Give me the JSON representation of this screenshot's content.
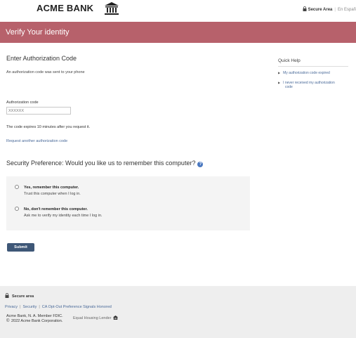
{
  "header": {
    "brand": "ACME BANK",
    "secure_area": "Secure Area",
    "language_link": "En Españ"
  },
  "banner": {
    "title": "Verify Your identity"
  },
  "auth": {
    "heading": "Enter Authorization Code",
    "sent_message": "An authorization code was sent to your phone",
    "field_label": "Authorization code",
    "field_placeholder": "XXXXXX",
    "expire_note": "The code expires 10 minutes after you request it.",
    "request_link": "Request another authorization code"
  },
  "quick_help": {
    "title": "Quick Help",
    "links": [
      {
        "line1": "My authorization code expired",
        "line2": ""
      },
      {
        "line1": "I never received my authorization",
        "line2": "code"
      }
    ]
  },
  "security": {
    "question": "Security Preference: Would you like us to remember this computer?",
    "options": [
      {
        "title": "Yes, remember this computer.",
        "desc": "Trust this computer when I log in."
      },
      {
        "title": "No, don't remember this computer.",
        "desc": "Ask me to verify my identity each time I log in."
      }
    ]
  },
  "submit_label": "Submit",
  "footer": {
    "secure_area": "Secure area",
    "links": [
      "Privacy",
      "Security",
      "CA Opt-Out Preference Signals Honored"
    ],
    "legal_line1": "Acme Bank, N. A. Member FDIC.",
    "legal_copy": "©",
    "legal_line2": "2022 Acme Bank Corporation.",
    "equal_housing": "Equal Housing Lender"
  },
  "colors": {
    "banner": "#b7616b",
    "link": "#4a6a99",
    "button": "#3e5777",
    "help_icon": "#4a78c0"
  }
}
